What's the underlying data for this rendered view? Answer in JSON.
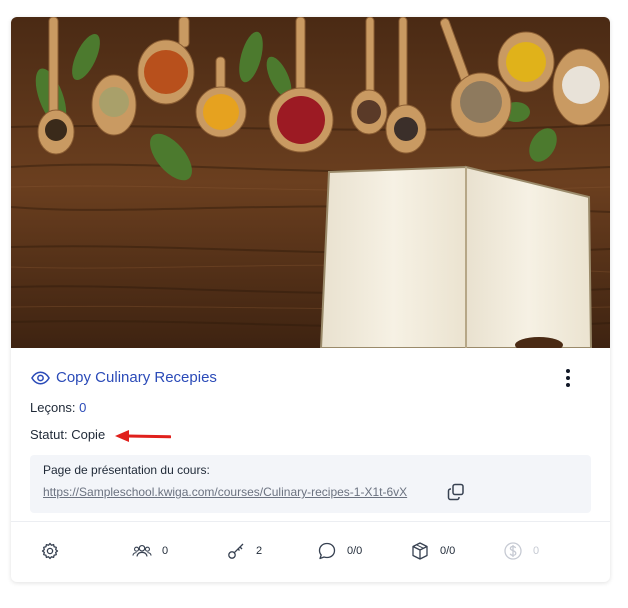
{
  "course": {
    "title": "Copy Culinary Recepies",
    "lessons_label": "Leçons:",
    "lessons_count": "0",
    "status_label": "Statut:",
    "status_value": "Copie"
  },
  "presentation": {
    "label": "Page de présentation du cours:",
    "url": "https://Sampleschool.kwiga.com/courses/Culinary-recipes-1-X1t-6vX"
  },
  "stats": {
    "settings": "",
    "students": "0",
    "keys": "2",
    "comments": "0/0",
    "packages": "0/0",
    "revenue": "0"
  },
  "colors": {
    "link": "#2b4bb8",
    "annotation_arrow": "#e0201c",
    "wood": "#6b3f1f"
  },
  "icons": [
    "eye-icon",
    "kebab-menu-icon",
    "copy-icon",
    "gear-icon",
    "users-icon",
    "key-icon",
    "comment-icon",
    "cube-icon",
    "dollar-icon"
  ]
}
